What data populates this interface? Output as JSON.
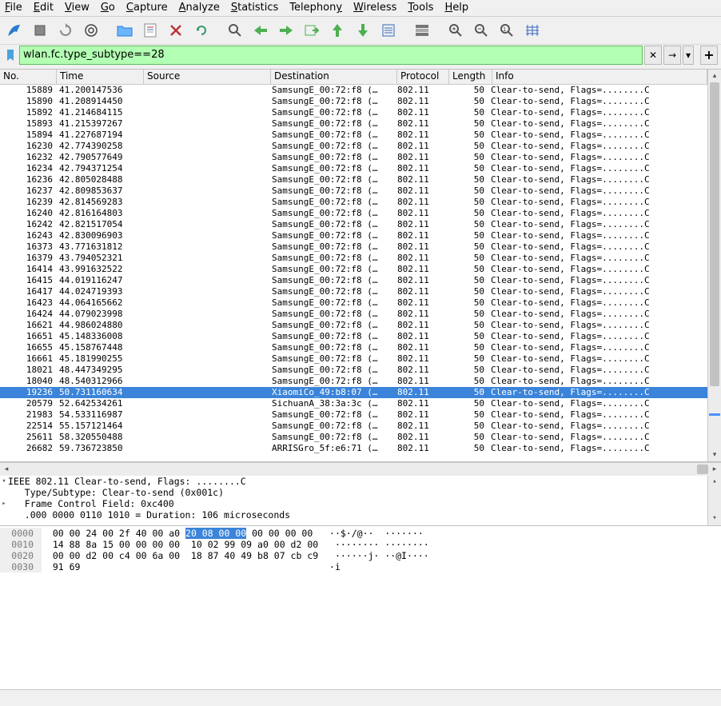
{
  "menu": {
    "items": [
      {
        "u": "F",
        "rest": "ile"
      },
      {
        "u": "E",
        "rest": "dit"
      },
      {
        "u": "V",
        "rest": "iew"
      },
      {
        "u": "G",
        "rest": "o"
      },
      {
        "u": "C",
        "rest": "apture"
      },
      {
        "u": "A",
        "rest": "nalyze"
      },
      {
        "u": "S",
        "rest": "tatistics"
      },
      {
        "u": "",
        "rest": "Telephon",
        "u2": "y"
      },
      {
        "u": "W",
        "rest": "ireless"
      },
      {
        "u": "T",
        "rest": "ools"
      },
      {
        "u": "H",
        "rest": "elp"
      }
    ]
  },
  "filter": {
    "value": "wlan.fc.type_subtype==28"
  },
  "columns": [
    "No.",
    "Time",
    "Source",
    "Destination",
    "Protocol",
    "Length",
    "Info"
  ],
  "rows": [
    {
      "no": "15889",
      "time": "41.200147536",
      "src": "",
      "dst": "SamsungE_00:72:f8 (…",
      "proto": "802.11",
      "len": "50",
      "info": "Clear-to-send, Flags=........C"
    },
    {
      "no": "15890",
      "time": "41.208914450",
      "src": "",
      "dst": "SamsungE_00:72:f8 (…",
      "proto": "802.11",
      "len": "50",
      "info": "Clear-to-send, Flags=........C"
    },
    {
      "no": "15892",
      "time": "41.214684115",
      "src": "",
      "dst": "SamsungE_00:72:f8 (…",
      "proto": "802.11",
      "len": "50",
      "info": "Clear-to-send, Flags=........C"
    },
    {
      "no": "15893",
      "time": "41.215397267",
      "src": "",
      "dst": "SamsungE_00:72:f8 (…",
      "proto": "802.11",
      "len": "50",
      "info": "Clear-to-send, Flags=........C"
    },
    {
      "no": "15894",
      "time": "41.227687194",
      "src": "",
      "dst": "SamsungE_00:72:f8 (…",
      "proto": "802.11",
      "len": "50",
      "info": "Clear-to-send, Flags=........C"
    },
    {
      "no": "16230",
      "time": "42.774390258",
      "src": "",
      "dst": "SamsungE_00:72:f8 (…",
      "proto": "802.11",
      "len": "50",
      "info": "Clear-to-send, Flags=........C"
    },
    {
      "no": "16232",
      "time": "42.790577649",
      "src": "",
      "dst": "SamsungE_00:72:f8 (…",
      "proto": "802.11",
      "len": "50",
      "info": "Clear-to-send, Flags=........C"
    },
    {
      "no": "16234",
      "time": "42.794371254",
      "src": "",
      "dst": "SamsungE_00:72:f8 (…",
      "proto": "802.11",
      "len": "50",
      "info": "Clear-to-send, Flags=........C"
    },
    {
      "no": "16236",
      "time": "42.805028488",
      "src": "",
      "dst": "SamsungE_00:72:f8 (…",
      "proto": "802.11",
      "len": "50",
      "info": "Clear-to-send, Flags=........C"
    },
    {
      "no": "16237",
      "time": "42.809853637",
      "src": "",
      "dst": "SamsungE_00:72:f8 (…",
      "proto": "802.11",
      "len": "50",
      "info": "Clear-to-send, Flags=........C"
    },
    {
      "no": "16239",
      "time": "42.814569283",
      "src": "",
      "dst": "SamsungE_00:72:f8 (…",
      "proto": "802.11",
      "len": "50",
      "info": "Clear-to-send, Flags=........C"
    },
    {
      "no": "16240",
      "time": "42.816164803",
      "src": "",
      "dst": "SamsungE_00:72:f8 (…",
      "proto": "802.11",
      "len": "50",
      "info": "Clear-to-send, Flags=........C"
    },
    {
      "no": "16242",
      "time": "42.821517054",
      "src": "",
      "dst": "SamsungE_00:72:f8 (…",
      "proto": "802.11",
      "len": "50",
      "info": "Clear-to-send, Flags=........C"
    },
    {
      "no": "16243",
      "time": "42.830096903",
      "src": "",
      "dst": "SamsungE_00:72:f8 (…",
      "proto": "802.11",
      "len": "50",
      "info": "Clear-to-send, Flags=........C"
    },
    {
      "no": "16373",
      "time": "43.771631812",
      "src": "",
      "dst": "SamsungE_00:72:f8 (…",
      "proto": "802.11",
      "len": "50",
      "info": "Clear-to-send, Flags=........C"
    },
    {
      "no": "16379",
      "time": "43.794052321",
      "src": "",
      "dst": "SamsungE_00:72:f8 (…",
      "proto": "802.11",
      "len": "50",
      "info": "Clear-to-send, Flags=........C"
    },
    {
      "no": "16414",
      "time": "43.991632522",
      "src": "",
      "dst": "SamsungE_00:72:f8 (…",
      "proto": "802.11",
      "len": "50",
      "info": "Clear-to-send, Flags=........C"
    },
    {
      "no": "16415",
      "time": "44.019116247",
      "src": "",
      "dst": "SamsungE_00:72:f8 (…",
      "proto": "802.11",
      "len": "50",
      "info": "Clear-to-send, Flags=........C"
    },
    {
      "no": "16417",
      "time": "44.024719393",
      "src": "",
      "dst": "SamsungE_00:72:f8 (…",
      "proto": "802.11",
      "len": "50",
      "info": "Clear-to-send, Flags=........C"
    },
    {
      "no": "16423",
      "time": "44.064165662",
      "src": "",
      "dst": "SamsungE_00:72:f8 (…",
      "proto": "802.11",
      "len": "50",
      "info": "Clear-to-send, Flags=........C"
    },
    {
      "no": "16424",
      "time": "44.079023998",
      "src": "",
      "dst": "SamsungE_00:72:f8 (…",
      "proto": "802.11",
      "len": "50",
      "info": "Clear-to-send, Flags=........C"
    },
    {
      "no": "16621",
      "time": "44.986024880",
      "src": "",
      "dst": "SamsungE_00:72:f8 (…",
      "proto": "802.11",
      "len": "50",
      "info": "Clear-to-send, Flags=........C"
    },
    {
      "no": "16651",
      "time": "45.148336008",
      "src": "",
      "dst": "SamsungE_00:72:f8 (…",
      "proto": "802.11",
      "len": "50",
      "info": "Clear-to-send, Flags=........C"
    },
    {
      "no": "16655",
      "time": "45.158767448",
      "src": "",
      "dst": "SamsungE_00:72:f8 (…",
      "proto": "802.11",
      "len": "50",
      "info": "Clear-to-send, Flags=........C"
    },
    {
      "no": "16661",
      "time": "45.181990255",
      "src": "",
      "dst": "SamsungE_00:72:f8 (…",
      "proto": "802.11",
      "len": "50",
      "info": "Clear-to-send, Flags=........C"
    },
    {
      "no": "18021",
      "time": "48.447349295",
      "src": "",
      "dst": "SamsungE_00:72:f8 (…",
      "proto": "802.11",
      "len": "50",
      "info": "Clear-to-send, Flags=........C"
    },
    {
      "no": "18040",
      "time": "48.540312966",
      "src": "",
      "dst": "SamsungE_00:72:f8 (…",
      "proto": "802.11",
      "len": "50",
      "info": "Clear-to-send, Flags=........C"
    },
    {
      "no": "19236",
      "time": "50.731160634",
      "src": "",
      "dst": "XiaomiCo_49:b8:07 (…",
      "proto": "802.11",
      "len": "50",
      "info": "Clear-to-send, Flags=........C",
      "sel": true
    },
    {
      "no": "20579",
      "time": "52.642534261",
      "src": "",
      "dst": "SichuanA_38:3a:3c (…",
      "proto": "802.11",
      "len": "50",
      "info": "Clear-to-send, Flags=........C"
    },
    {
      "no": "21983",
      "time": "54.533116987",
      "src": "",
      "dst": "SamsungE_00:72:f8 (…",
      "proto": "802.11",
      "len": "50",
      "info": "Clear-to-send, Flags=........C"
    },
    {
      "no": "22514",
      "time": "55.157121464",
      "src": "",
      "dst": "SamsungE_00:72:f8 (…",
      "proto": "802.11",
      "len": "50",
      "info": "Clear-to-send, Flags=........C"
    },
    {
      "no": "25611",
      "time": "58.320550488",
      "src": "",
      "dst": "SamsungE_00:72:f8 (…",
      "proto": "802.11",
      "len": "50",
      "info": "Clear-to-send, Flags=........C"
    },
    {
      "no": "26682",
      "time": "59.736723850",
      "src": "",
      "dst": "ARRISGro_5f:e6:71 (…",
      "proto": "802.11",
      "len": "50",
      "info": "Clear-to-send, Flags=........C"
    }
  ],
  "details": [
    "IEEE 802.11 Clear-to-send, Flags: ........C",
    "   Type/Subtype: Clear-to-send (0x001c)",
    "   Frame Control Field: 0xc400",
    "   .000 0000 0110 1010 = Duration: 106 microseconds"
  ],
  "hex": [
    {
      "off": "0000",
      "b1": "00 00 24 00 2f 40 00 a0 ",
      "bsel": "20 08 00 00",
      "b2": " 00 00 00 00",
      "a": "   ··$·/@··  ·······"
    },
    {
      "off": "0010",
      "b1": "14 88 8a 15 00 00 00 00  10 02 99 09 a0 00 d2 00",
      "bsel": "",
      "b2": "",
      "a": "   ········ ········"
    },
    {
      "off": "0020",
      "b1": "00 00 d2 00 c4 00 6a 00  18 87 40 49 b8 07 cb c9",
      "bsel": "",
      "b2": "",
      "a": "   ······j· ··@I····"
    },
    {
      "off": "0030",
      "b1": "91 69",
      "bsel": "",
      "b2": "",
      "a": "                                             ·i"
    }
  ]
}
